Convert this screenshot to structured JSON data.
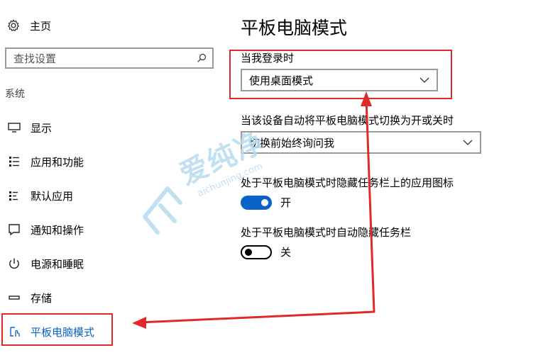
{
  "sidebar": {
    "home_label": "主页",
    "search_placeholder": "查找设置",
    "section_label": "系统",
    "items": [
      {
        "label": "显示",
        "icon": "monitor-icon"
      },
      {
        "label": "应用和功能",
        "icon": "apps-list-icon"
      },
      {
        "label": "默认应用",
        "icon": "default-apps-icon"
      },
      {
        "label": "通知和操作",
        "icon": "notification-icon"
      },
      {
        "label": "电源和睡眠",
        "icon": "power-icon"
      },
      {
        "label": "存储",
        "icon": "storage-icon"
      },
      {
        "label": "平板电脑模式",
        "icon": "tablet-mode-icon",
        "active": true
      }
    ]
  },
  "main": {
    "title": "平板电脑模式",
    "signin_label": "当我登录时",
    "signin_value": "使用桌面模式",
    "autoswitch_label": "当该设备自动将平板电脑模式切换为开或关时",
    "autoswitch_value": "切换前始终询问我",
    "hide_icons_label": "处于平板电脑模式时隐藏任务栏上的应用图标",
    "hide_icons_state": "开",
    "hide_taskbar_label": "处于平板电脑模式时自动隐藏任务栏",
    "hide_taskbar_state": "关"
  },
  "watermark": {
    "text": "爱纯净",
    "url": "aichunjing.com"
  },
  "colors": {
    "accent": "#0a64c8",
    "annotation": "#e02a2a",
    "watermark": "#b7dcf2"
  }
}
